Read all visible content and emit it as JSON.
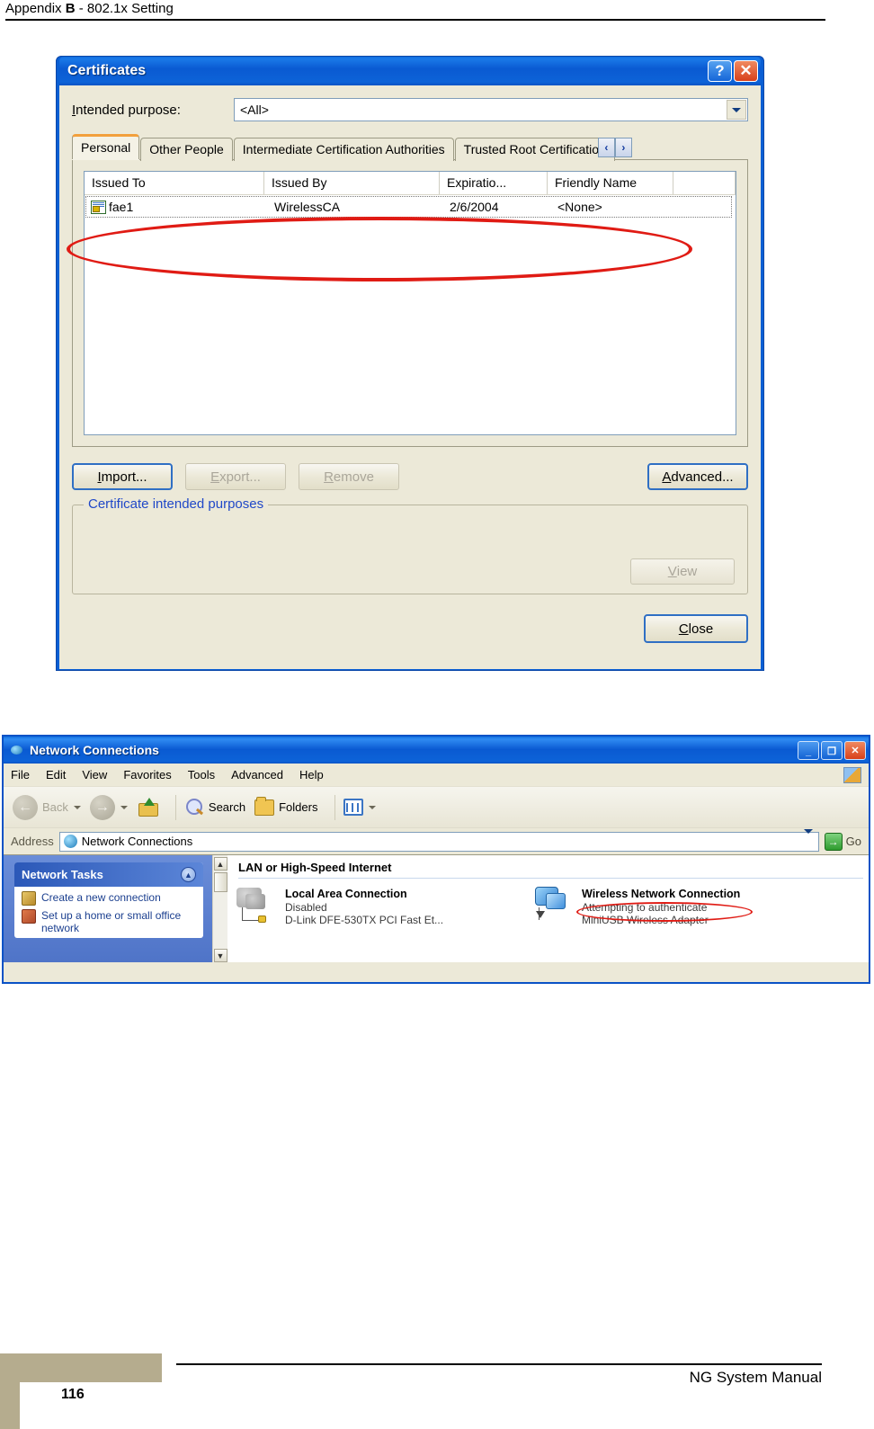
{
  "page": {
    "header_prefix": "Appendix ",
    "header_bold": "B",
    "header_suffix": " - 802.1x Setting",
    "footer_manual": "NG System Manual",
    "page_number": "116"
  },
  "certificates_dialog": {
    "title": "Certificates",
    "help_button": "?",
    "close_button": "✕",
    "intended_purpose_label": "Intended purpose:",
    "intended_purpose_value": "<All>",
    "tabs": [
      {
        "label": "Personal",
        "active": true
      },
      {
        "label": "Other People",
        "active": false
      },
      {
        "label": "Intermediate Certification Authorities",
        "active": false
      },
      {
        "label": "Trusted Root Certification",
        "active": false
      }
    ],
    "tab_scroll_left": "‹",
    "tab_scroll_right": "›",
    "list": {
      "columns": [
        "Issued To",
        "Issued By",
        "Expiratio...",
        "Friendly Name"
      ],
      "rows": [
        {
          "issued_to": "fae1",
          "issued_by": "WirelessCA",
          "expiration": "2/6/2004",
          "friendly_name": "<None>"
        }
      ]
    },
    "buttons": {
      "import": "Import...",
      "export": "Export...",
      "remove": "Remove",
      "advanced": "Advanced...",
      "view": "View",
      "close": "Close"
    },
    "groupbox_title": "Certificate intended purposes",
    "groupbox_content": ""
  },
  "network_connections": {
    "title": "Network Connections",
    "window_buttons": {
      "minimize": "_",
      "maximize": "❐",
      "close": "✕"
    },
    "menus": [
      "File",
      "Edit",
      "View",
      "Favorites",
      "Tools",
      "Advanced",
      "Help"
    ],
    "toolbar": {
      "back": "Back",
      "forward": "",
      "up": "",
      "search": "Search",
      "folders": "Folders",
      "views": ""
    },
    "address": {
      "label": "Address",
      "value": "Network Connections",
      "go_label": "Go"
    },
    "sidebar": {
      "panel_title": "Network Tasks",
      "items": [
        "Create a new connection",
        "Set up a home or small office network"
      ]
    },
    "main": {
      "section_title": "LAN or High-Speed Internet",
      "connections": [
        {
          "name": "Local Area Connection",
          "status": "Disabled",
          "device": "D-Link DFE-530TX PCI Fast Et..."
        },
        {
          "name": "Wireless Network Connection",
          "status": "Attempting to authenticate",
          "device": "MiniUSB Wireless Adapter"
        }
      ]
    }
  },
  "annotations": {
    "highlight_color": "#e01b14",
    "circled_certificate_row": "fae1 certificate row",
    "circled_status": "Attempting to authenticate"
  }
}
